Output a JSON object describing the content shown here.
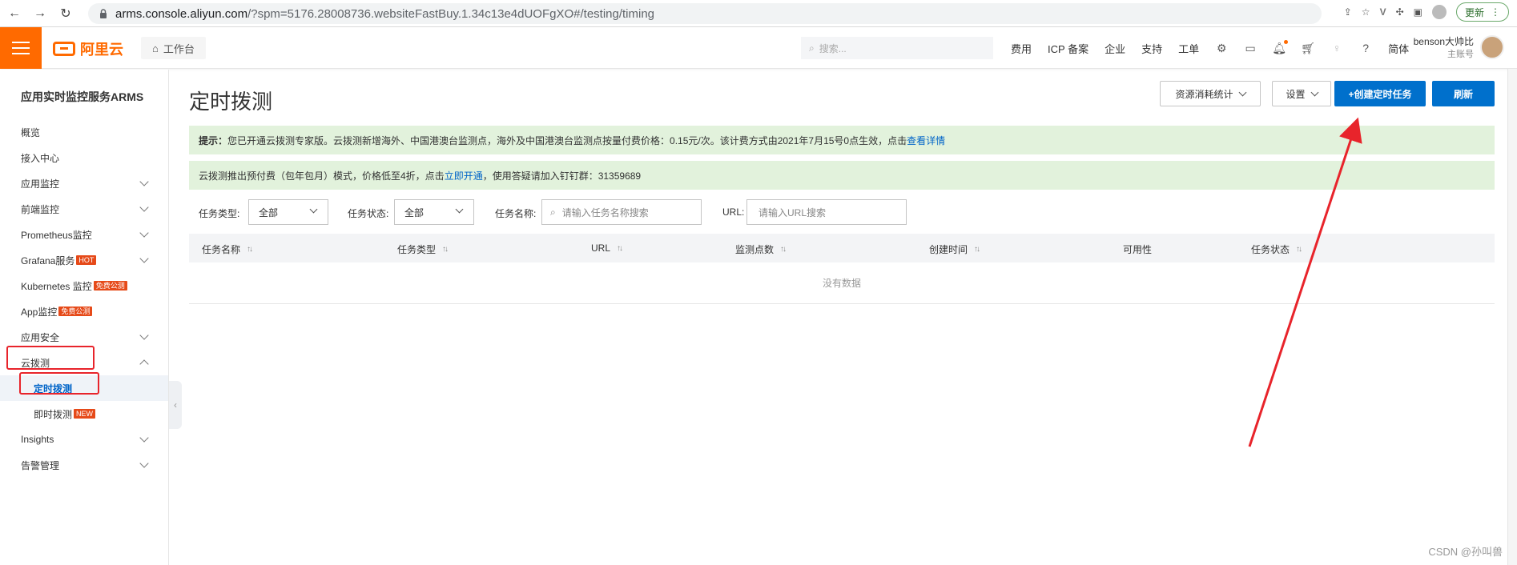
{
  "browser": {
    "url_prefix": "arms.console.aliyun.com",
    "url_rest": "/?spm=5176.28008736.websiteFastBuy.1.34c13e4dUOFgXO#/testing/timing",
    "update_label": "更新"
  },
  "topnav": {
    "logo_text": "阿里云",
    "workbench_label": "工作台",
    "search_placeholder": "搜索...",
    "links": [
      "费用",
      "ICP 备案",
      "企业",
      "支持",
      "工单"
    ],
    "lang": "简体",
    "user_name": "benson大帅比",
    "user_role": "主账号"
  },
  "sidebar": {
    "title": "应用实时监控服务ARMS",
    "items": [
      {
        "label": "概览"
      },
      {
        "label": "接入中心"
      },
      {
        "label": "应用监控"
      },
      {
        "label": "前端监控"
      },
      {
        "label": "Prometheus监控"
      },
      {
        "label": "Grafana服务",
        "badge": "HOT"
      },
      {
        "label": "Kubernetes 监控",
        "badge": "免费公测"
      },
      {
        "label": "App监控",
        "badge": "免费公测"
      },
      {
        "label": "应用安全"
      },
      {
        "label": "云拨测"
      },
      {
        "label": "定时拨测"
      },
      {
        "label": "即时拨测",
        "badge": "NEW"
      },
      {
        "label": "Insights"
      },
      {
        "label": "告警管理"
      }
    ]
  },
  "main": {
    "title": "定时拨测",
    "btn_resource": "资源消耗统计",
    "btn_settings": "设置",
    "btn_create": "+创建定时任务",
    "btn_refresh": "刷新",
    "notice1_prefix": "提示：",
    "notice1_text": "您已开通云拨测专家版。云拨测新增海外、中国港澳台监测点，海外及中国港澳台监测点按量付费价格：0.15元/次。该计费方式由2021年7月15号0点生效，点击",
    "notice1_link": "查看详情",
    "notice2_text": "云拨测推出预付费（包年包月）模式，价格低至4折，点击",
    "notice2_link": "立即开通",
    "notice2_suffix": "，使用答疑请加入钉钉群：31359689",
    "filter_type_label": "任务类型:",
    "filter_type_value": "全部",
    "filter_status_label": "任务状态:",
    "filter_status_value": "全部",
    "filter_name_label": "任务名称:",
    "filter_name_placeholder": "请输入任务名称搜索",
    "filter_url_label": "URL:",
    "filter_url_placeholder": "请输入URL搜索",
    "columns": [
      "任务名称",
      "任务类型",
      "URL",
      "监测点数",
      "创建时间",
      "可用性",
      "任务状态"
    ],
    "empty_text": "没有数据"
  },
  "watermark": "CSDN @孙叫兽"
}
